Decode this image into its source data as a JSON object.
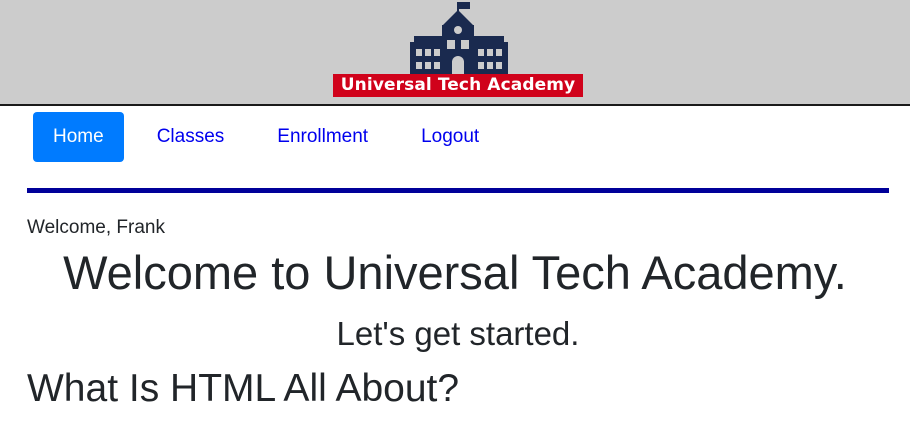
{
  "header": {
    "logo_text": "Universal Tech Academy",
    "colors": {
      "background": "#cccccc",
      "building": "#1a2a4f",
      "banner": "#d0021b"
    },
    "logo_icon": "school-building-icon"
  },
  "nav": {
    "items": [
      {
        "label": "Home",
        "active": true
      },
      {
        "label": "Classes",
        "active": false
      },
      {
        "label": "Enrollment",
        "active": false
      },
      {
        "label": "Logout",
        "active": false
      }
    ],
    "active_color": "#007bff",
    "link_color": "#0000ee"
  },
  "rule_color": "#000099",
  "main": {
    "welcome_user": "Welcome, Frank",
    "heading": "Welcome to Universal Tech Academy.",
    "subheading": "Let's get started.",
    "section_title": "What Is HTML All About?"
  }
}
